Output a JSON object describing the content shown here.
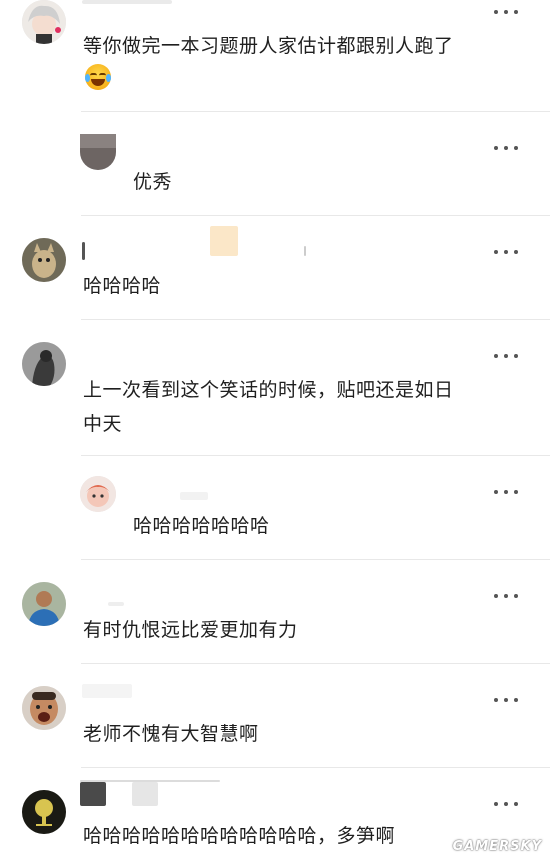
{
  "comments": [
    {
      "text": "等你做完一本习题册人家估计都跟别人跑了",
      "emoji": "crying-laughing-emoji",
      "avatar": "anime-character-avatar"
    },
    {
      "text": "优秀",
      "reply": true,
      "avatar": "dark-avatar"
    },
    {
      "text": "哈哈哈哈",
      "avatar": "cat-avatar"
    },
    {
      "text_line1": "上一次看到这个笑话的时候，贴吧还是如日",
      "text_line2": "中天",
      "avatar": "grey-portrait-avatar"
    },
    {
      "text": "哈哈哈哈哈哈哈",
      "reply": true,
      "avatar": "pink-cartoon-avatar"
    },
    {
      "text": "有时仇恨远比爱更加有力",
      "avatar": "person-blue-jersey-avatar"
    },
    {
      "text": "老师不愧有大智慧啊",
      "avatar": "surprised-man-avatar"
    },
    {
      "text": "哈哈哈哈哈哈哈哈哈哈哈哈，多笋啊",
      "avatar": "dark-tree-avatar"
    }
  ],
  "watermark": "GAMERSKY"
}
